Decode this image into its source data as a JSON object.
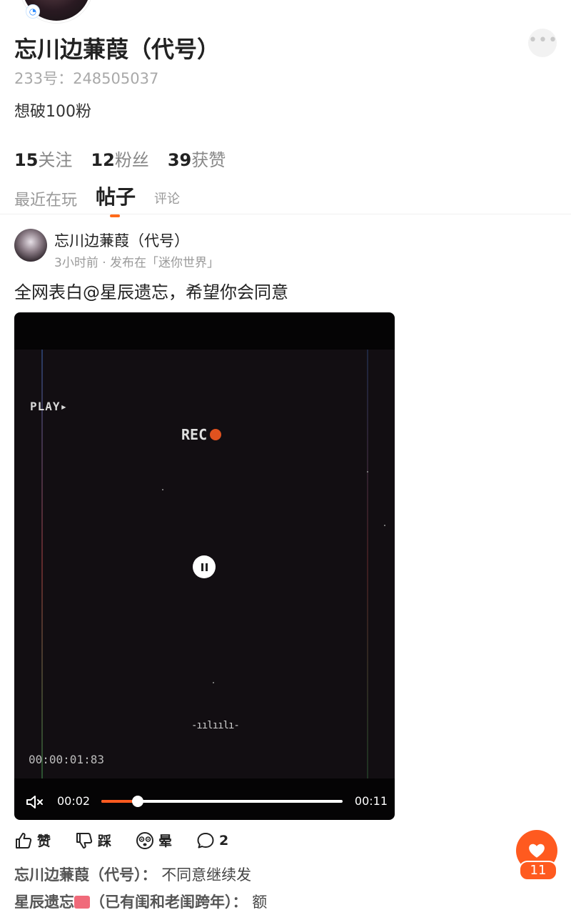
{
  "profile": {
    "name": "忘川边蒹葭（代号）",
    "id_text": "233号：248505037",
    "bio": "想破100粉",
    "more_icon": "more-horizontal-icon",
    "stats": [
      {
        "num": "15",
        "label": "关注"
      },
      {
        "num": "12",
        "label": "粉丝"
      },
      {
        "num": "39",
        "label": "获赞"
      }
    ]
  },
  "tabs": [
    {
      "label": "最近在玩"
    },
    {
      "label": "帖子",
      "active": true
    },
    {
      "label": "评论"
    }
  ],
  "post": {
    "author": "忘川边蒹葭（代号）",
    "meta": "3小时前 · 发布在「迷你世界」",
    "text": "全网表白@星辰遗忘，希望你会同意",
    "video": {
      "overlay_play": "PLAY▸",
      "overlay_rec": "REC",
      "overlay_timecode": "00:00:01:83",
      "overlay_wave": "-ıılıılı-",
      "current_time": "00:02",
      "total_time": "00:11",
      "progress": 0.15,
      "accent": "#ff5a1f"
    },
    "actions": [
      {
        "label": "赞",
        "icon": "thumb-up-icon"
      },
      {
        "label": "踩",
        "icon": "thumb-down-icon"
      },
      {
        "label": "晕",
        "icon": "dizzy-face-icon"
      },
      {
        "label": "2",
        "icon": "comment-bubble-icon"
      }
    ],
    "comments": [
      {
        "who": "忘川边蒹葭（代号）",
        "sep": "：",
        "what": "不同意继续发"
      },
      {
        "who_a": "星辰遗忘",
        "who_b": "（已有闺和老闺跨年）",
        "sep": "：",
        "what": "额"
      }
    ]
  },
  "fab": {
    "count": "11",
    "icon": "heart-icon",
    "color": "#ff5a1f"
  }
}
